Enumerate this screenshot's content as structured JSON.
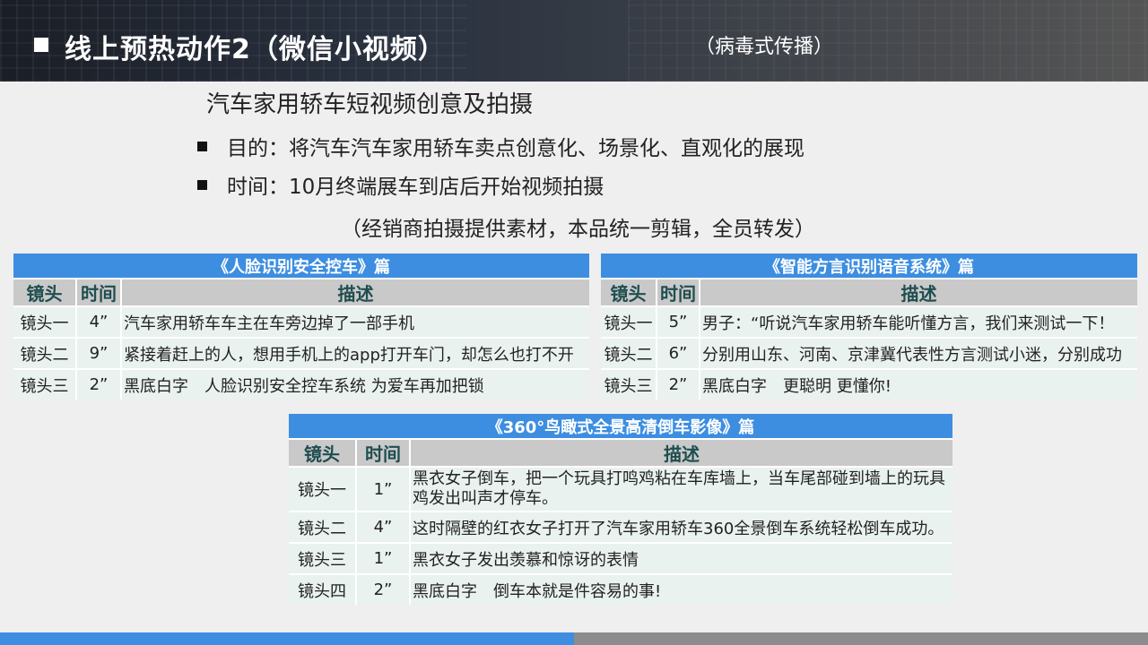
{
  "header": {
    "title": "线上预热动作2（微信小视频）",
    "subtitle": "（病毒式传播）"
  },
  "main": {
    "heading": "汽车家用轿车短视频创意及拍摄",
    "bullets": [
      "目的：将汽车汽车家用轿车卖点创意化、场景化、直观化的展现",
      "时间：10月终端展车到店后开始视频拍摄"
    ],
    "note": "（经销商拍摄提供素材，本品统一剪辑，全员转发）"
  },
  "tables": [
    {
      "caption": "《人脸识别安全控车》篇",
      "headers": [
        "镜头",
        "时间",
        "描述"
      ],
      "rows": [
        [
          "镜头一",
          "4”",
          "汽车家用轿车车主在车旁边掉了一部手机"
        ],
        [
          "镜头二",
          "9”",
          "紧接着赶上的人，想用手机上的app打开车门，却怎么也打不开"
        ],
        [
          "镜头三",
          "2”",
          "黑底白字　人脸识别安全控车系统 为爱车再加把锁"
        ]
      ]
    },
    {
      "caption": "《智能方言识别语音系统》篇",
      "headers": [
        "镜头",
        "时间",
        "描述"
      ],
      "rows": [
        [
          "镜头一",
          "5”",
          "男子：“听说汽车家用轿车能听懂方言，我们来测试一下！"
        ],
        [
          "镜头二",
          "6”",
          "分别用山东、河南、京津冀代表性方言测试小迷，分别成功"
        ],
        [
          "镜头三",
          "2”",
          "黑底白字　更聪明 更懂你!"
        ]
      ]
    },
    {
      "caption": "《360°鸟瞰式全景高清倒车影像》篇",
      "headers": [
        "镜头",
        "时间",
        "描述"
      ],
      "rows": [
        [
          "镜头一",
          "1”",
          "黑衣女子倒车，把一个玩具打鸣鸡粘在车库墙上，当车尾部碰到墙上的玩具鸡发出叫声才停车。"
        ],
        [
          "镜头二",
          "4”",
          "这时隔壁的红衣女子打开了汽车家用轿车360全景倒车系统轻松倒车成功。"
        ],
        [
          "镜头三",
          "1”",
          "黑衣女子发出羡慕和惊讶的表情"
        ],
        [
          "镜头四",
          "2”",
          "黑底白字　倒车本就是件容易的事!"
        ]
      ]
    }
  ],
  "colors": {
    "accent_blue": "#3d8ee0",
    "header_gray": "#c9c9c9",
    "row_bg": "#e9f2ef",
    "header_text": "#1f4e4f"
  }
}
